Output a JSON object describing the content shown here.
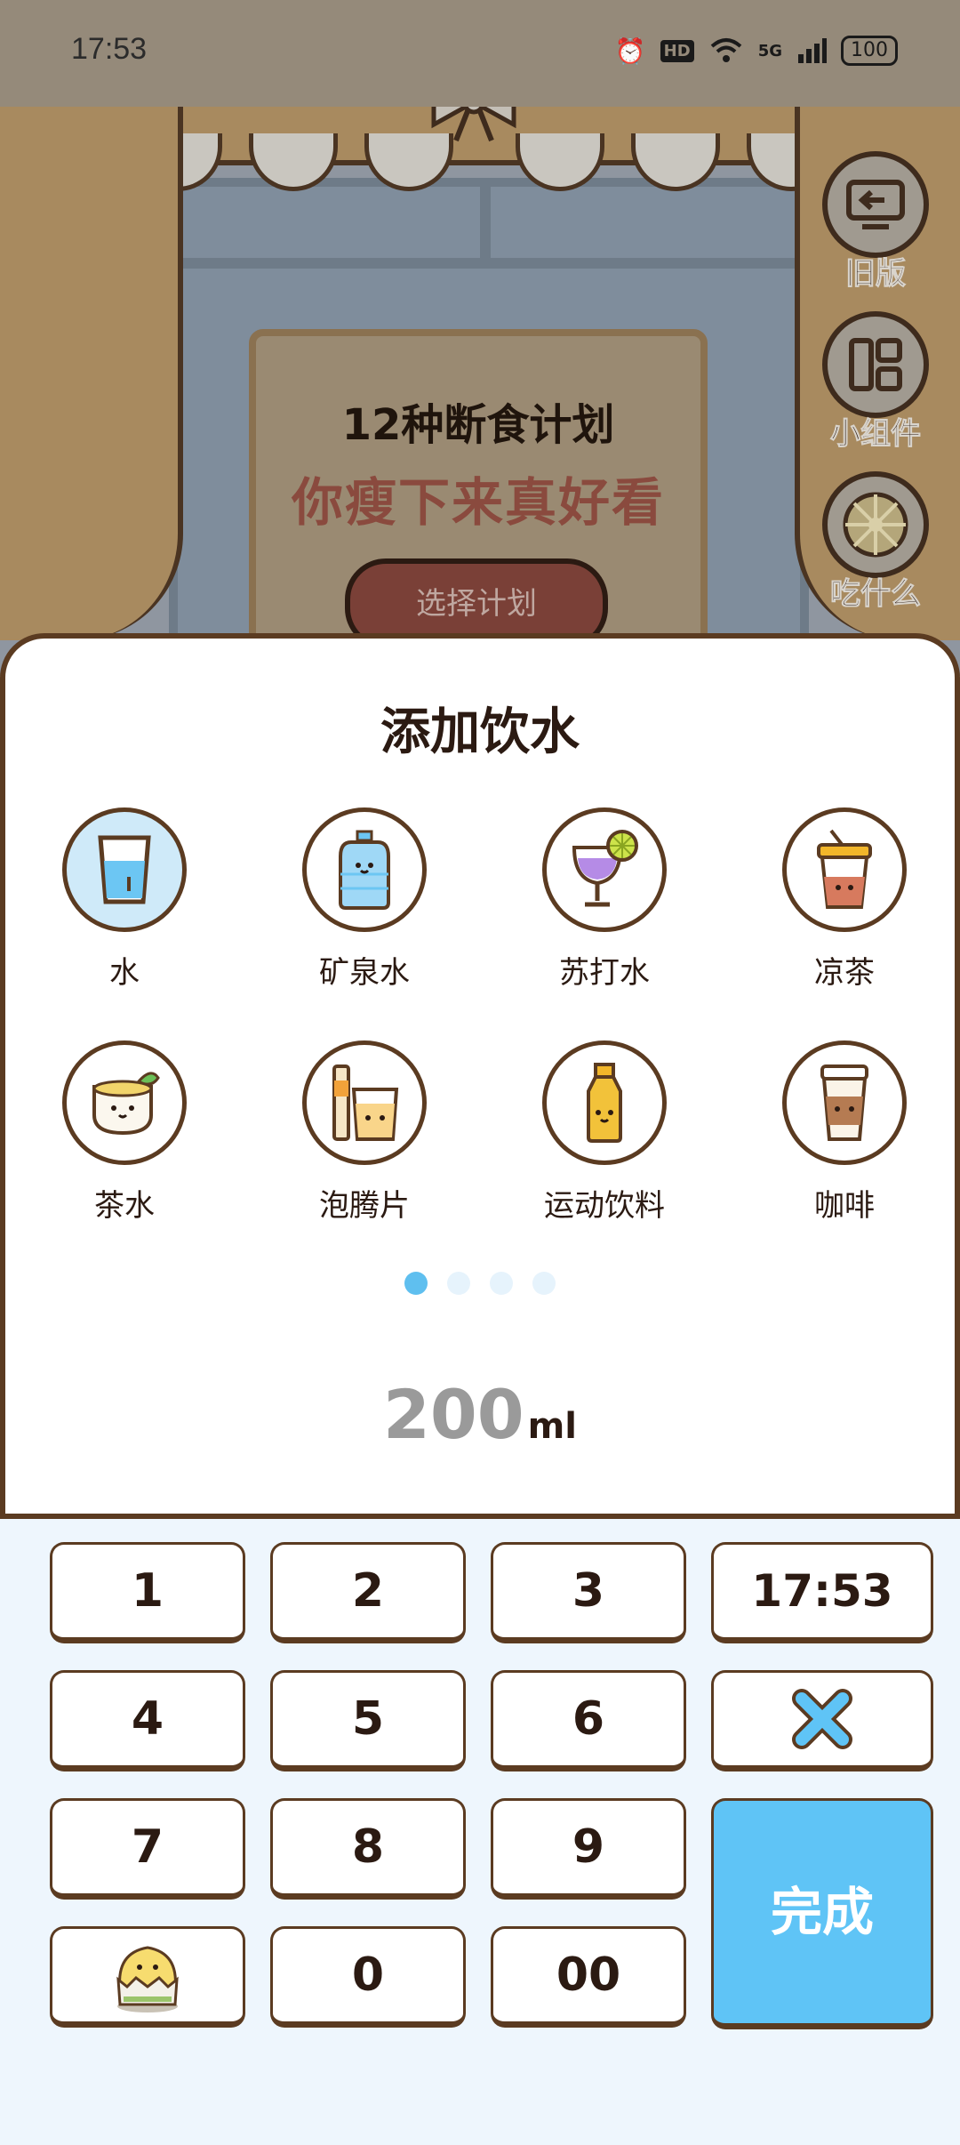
{
  "status_bar": {
    "time": "17:53",
    "network": "5G",
    "battery": "100",
    "hd_badge": "HD"
  },
  "background": {
    "poster_title": "12种断食计划",
    "poster_subtitle": "你瘦下来真好看",
    "poster_button": "选择计划"
  },
  "side_buttons": [
    {
      "label": "旧版",
      "icon": "back-screen-icon"
    },
    {
      "label": "小组件",
      "icon": "widget-grid-icon"
    },
    {
      "label": "吃什么",
      "icon": "food-wheel-icon"
    }
  ],
  "sheet": {
    "title": "添加饮水",
    "drinks": [
      {
        "label": "水",
        "icon": "water-glass-icon",
        "selected": true
      },
      {
        "label": "矿泉水",
        "icon": "water-bottle-icon",
        "selected": false
      },
      {
        "label": "苏打水",
        "icon": "soda-glass-icon",
        "selected": false
      },
      {
        "label": "凉茶",
        "icon": "iced-tea-icon",
        "selected": false
      },
      {
        "label": "茶水",
        "icon": "tea-cup-icon",
        "selected": false
      },
      {
        "label": "泡腾片",
        "icon": "effervescent-icon",
        "selected": false
      },
      {
        "label": "运动饮料",
        "icon": "sports-drink-icon",
        "selected": false
      },
      {
        "label": "咖啡",
        "icon": "coffee-cup-icon",
        "selected": false
      }
    ],
    "page_count": 4,
    "page_active": 1,
    "amount_value": "200",
    "amount_unit": "ml"
  },
  "keypad": {
    "k1": "1",
    "k2": "2",
    "k3": "3",
    "k4": "4",
    "k5": "5",
    "k6": "6",
    "k7": "7",
    "k8": "8",
    "k9": "9",
    "k0": "0",
    "k00": "00",
    "time": "17:53",
    "done": "完成",
    "delete_icon": "delete-x-icon",
    "mascot_icon": "chick-mascot-icon"
  },
  "colors": {
    "accent_blue": "#5fc4f6",
    "brown_outline": "#5b3b21",
    "dot_active": "#5fbfef"
  }
}
